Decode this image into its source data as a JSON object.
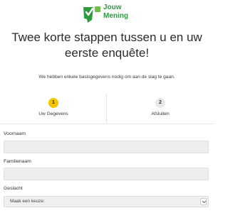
{
  "brand": {
    "logo_text_line1": "Jouw",
    "logo_text_line2": "Mening",
    "accent_color": "#2e9a3e",
    "step_active_color": "#f2c500"
  },
  "headline": {
    "line1": "Twee korte stappen tussen u en uw",
    "line2": "eerste enquête!"
  },
  "subtitle": "We hebben enkele basisgegevens nodig om aan de slag te gaan.",
  "steps": [
    {
      "number": "1",
      "label": "Uw Gegevens",
      "active": true
    },
    {
      "number": "2",
      "label": "Afsluiten",
      "active": false
    }
  ],
  "form": {
    "first_name_label": "Voornaam",
    "first_name_value": "",
    "last_name_label": "Familienaam",
    "last_name_value": "",
    "gender_label": "Geslacht",
    "gender_selected": "Maak een keuze:"
  }
}
